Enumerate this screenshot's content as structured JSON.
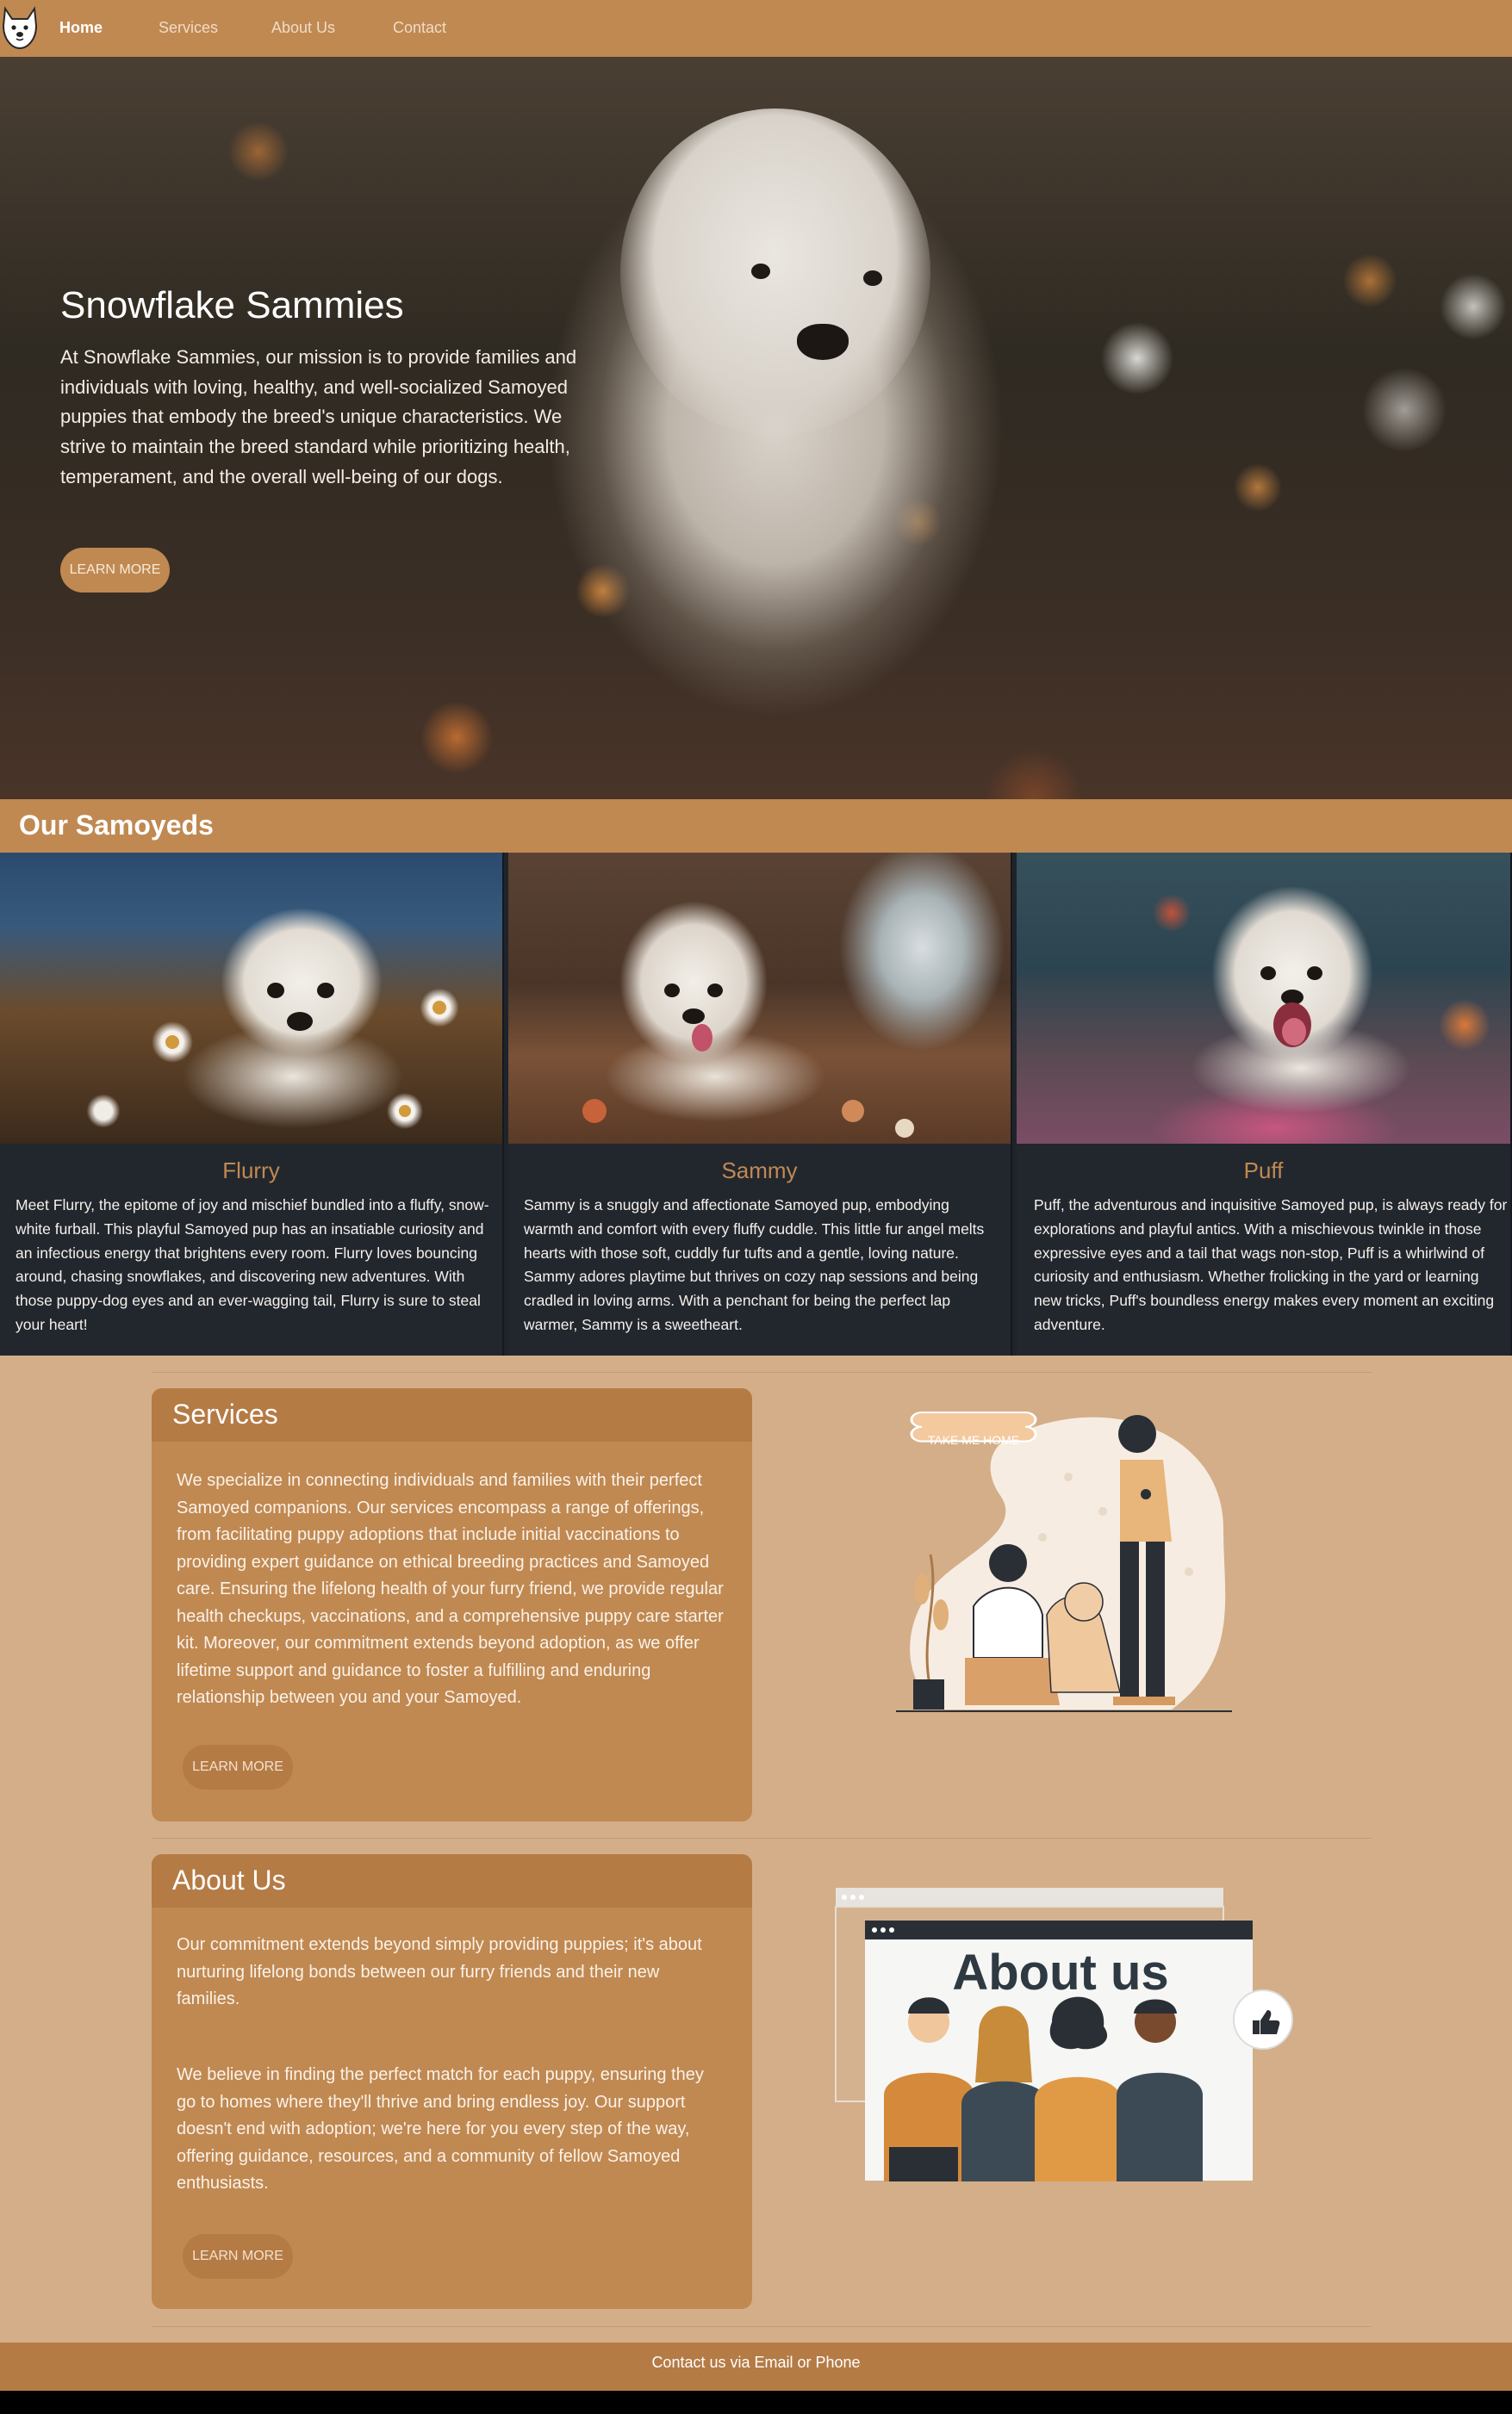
{
  "nav": {
    "items": [
      {
        "label": "Home",
        "active": true
      },
      {
        "label": "Services",
        "active": false
      },
      {
        "label": "About Us",
        "active": false
      },
      {
        "label": "Contact",
        "active": false
      }
    ]
  },
  "hero": {
    "title": "Snowflake Sammies",
    "text": "At Snowflake Sammies, our mission is to provide families and individuals with loving, healthy, and well-socialized Samoyed puppies that embody the breed's unique characteristics. We strive to maintain the breed standard while prioritizing health, temperament, and the overall well-being of our dogs.",
    "button": "LEARN MORE"
  },
  "samoyeds": {
    "title": "Our Samoyeds",
    "cards": [
      {
        "name": "Flurry",
        "text": "Meet Flurry, the epitome of joy and mischief bundled into a fluffy, snow-white furball. This playful Samoyed pup has an insatiable curiosity and an infectious energy that brightens every room. Flurry loves bouncing around, chasing snowflakes, and discovering new adventures. With those puppy-dog eyes and an ever-wagging tail, Flurry is sure to steal your heart!"
      },
      {
        "name": "Sammy",
        "text": "Sammy is a snuggly and affectionate Samoyed pup, embodying warmth and comfort with every fluffy cuddle. This little fur angel melts hearts with those soft, cuddly fur tufts and a gentle, loving nature. Sammy adores playtime but thrives on cozy nap sessions and being cradled in loving arms. With a penchant for being the perfect lap warmer, Sammy is a sweetheart."
      },
      {
        "name": "Puff",
        "text": "Puff, the adventurous and inquisitive Samoyed pup, is always ready for explorations and playful antics. With a mischievous twinkle in those expressive eyes and a tail that wags non-stop, Puff is a whirlwind of curiosity and enthusiasm. Whether frolicking in the yard or learning new tricks, Puff's boundless energy makes every moment an exciting adventure."
      }
    ]
  },
  "services": {
    "title": "Services",
    "text": "We specialize in connecting individuals and families with their perfect Samoyed companions. Our services encompass a range of offerings, from facilitating puppy adoptions that include initial vaccinations to providing expert guidance on ethical breeding practices and Samoyed care. Ensuring the lifelong health of your furry friend, we provide regular health checkups, vaccinations, and a comprehensive puppy care starter kit. Moreover, our commitment extends beyond adoption, as we offer lifetime support and guidance to foster a fulfilling and enduring relationship between you and your Samoyed.",
    "button": "LEARN MORE",
    "illustration_sign": "TAKE ME HOME"
  },
  "about": {
    "title": "About Us",
    "text1": "Our commitment extends beyond simply providing puppies; it's about nurturing lifelong bonds between our furry friends and their new families.",
    "text2": "We believe in finding the perfect match for each puppy, ensuring they go to homes where they'll thrive and bring endless joy. Our support doesn't end with adoption; we're here for you every step of the way, offering guidance, resources, and a community of fellow Samoyed enthusiasts.",
    "button": "LEARN MORE",
    "illustration_heading": "About us"
  },
  "footer": {
    "text": "Contact us via Email or Phone"
  },
  "colors": {
    "nav": "#c08952",
    "page_bg": "#d3ae89",
    "card_bg": "#22272e",
    "accent": "#c08952"
  }
}
